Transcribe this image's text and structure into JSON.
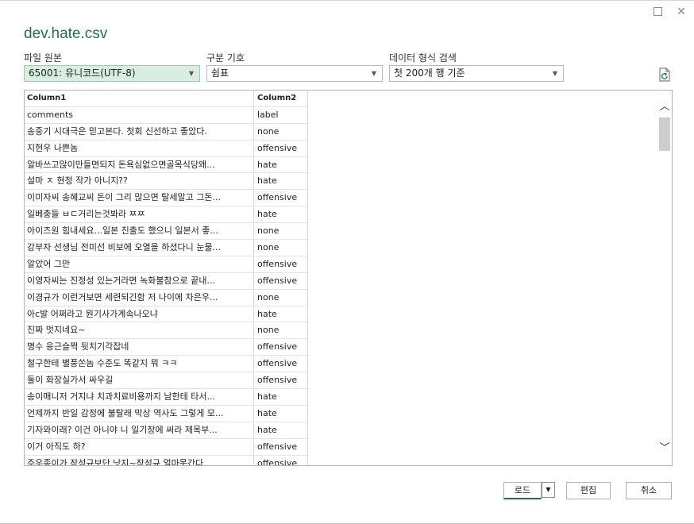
{
  "title": "dev.hate.csv",
  "file_origin": {
    "label": "파일 원본",
    "value": "65001: 유니코드(UTF-8)"
  },
  "delimiter": {
    "label": "구분 기호",
    "value": "쉼표"
  },
  "detection": {
    "label": "데이터 형식 검색",
    "value": "첫 200개 행 기준"
  },
  "table": {
    "headers": [
      "Column1",
      "Column2"
    ],
    "rows": [
      [
        "comments",
        "label"
      ],
      [
        "송중기 시대극은 믿고본다. 첫회 신선하고 좋았다.",
        "none"
      ],
      [
        "지현우 나쁜놈",
        "offensive"
      ],
      [
        "알바쓰고많이만들면되지 돈욕심없으면골목식당왜...",
        "hate"
      ],
      [
        "설마 ㅈ 현정 작가 아니지??",
        "hate"
      ],
      [
        "이미자씨 송혜교씨 돈이 그리 많으면 탈세말고 그돈...",
        "offensive"
      ],
      [
        "일베충들 ㅂㄷ거리는것봐라 ㅉㅉ",
        "hate"
      ],
      [
        "아이즈원 힘내세요...일본 진출도 했으니 일본서 좋...",
        "none"
      ],
      [
        "강부자 선생님 전미선 비보에 오열을 하셨다니 눈물...",
        "none"
      ],
      [
        "알았어 그만",
        "offensive"
      ],
      [
        "이영자씨는 진정성 있는거라면 녹화불참으로 끝내...",
        "offensive"
      ],
      [
        "이경규가 이런거보면 세련되긴함 저 나이에 차은우...",
        "none"
      ],
      [
        "아c발 어쩌라고 뭔기사가계속나오냐",
        "hate"
      ],
      [
        "진짜 멋지네요~",
        "none"
      ],
      [
        "명수 응근슬쩍 뒷치기각잡네",
        "offensive"
      ],
      [
        "철구한테 별풍쏜놈 수준도 똑같지 뭐 ㅋㅋ",
        "offensive"
      ],
      [
        "둘이 화장실가서 싸우길",
        "offensive"
      ],
      [
        "송이매니저 거지냐 치과치료비용까지 남한테 타서...",
        "hate"
      ],
      [
        "언제까지 반일 감정에 불탈래 막상 역사도 그렇게 모...",
        "hate"
      ],
      [
        "기자와이래? 이건 아니야 니 일기장에 써라 제목부...",
        "hate"
      ],
      [
        "이거 아직도 하?",
        "offensive"
      ],
      [
        "주우종이가 장성규보단 낫지~장성규 얼마못간다",
        "offensive"
      ]
    ]
  },
  "buttons": {
    "load": "로드",
    "edit": "편집",
    "cancel": "취소"
  },
  "colors": {
    "accent": "#217346",
    "selected_bg": "#d8eee0"
  },
  "icons": {
    "refresh": "refresh-icon",
    "close": "close-icon",
    "maximize": "maximize-icon"
  }
}
